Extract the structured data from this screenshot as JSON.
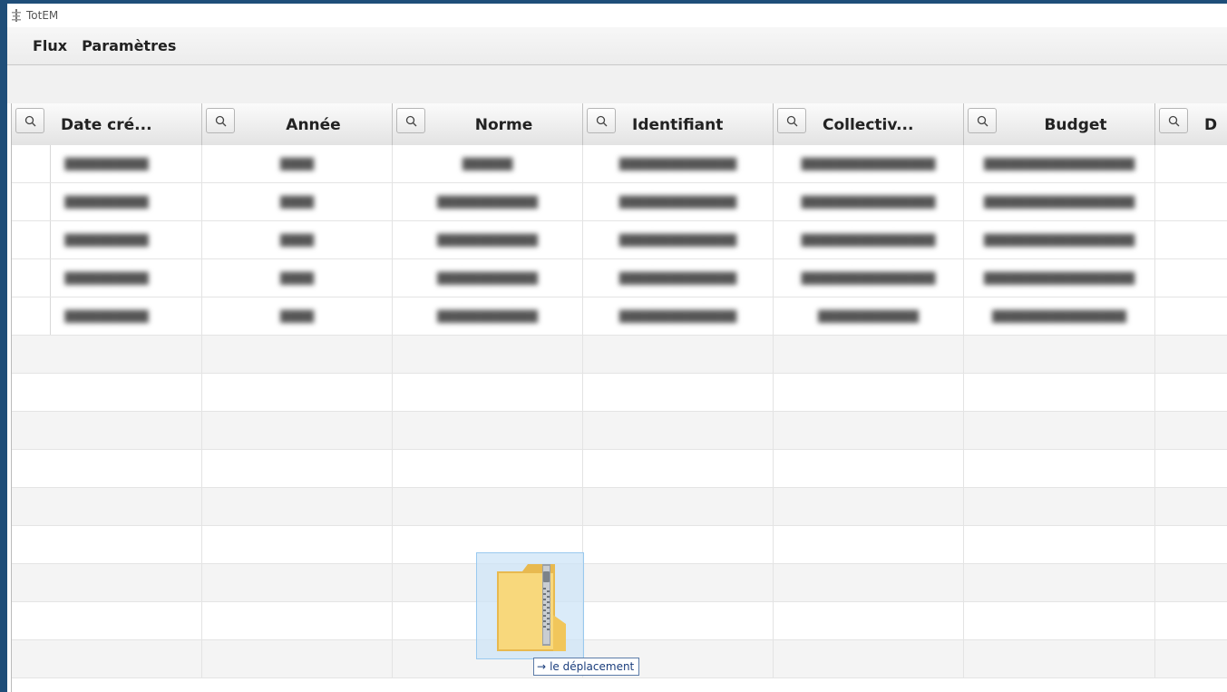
{
  "window": {
    "title": "TotEM"
  },
  "menu": [
    "Flux",
    "Paramètres"
  ],
  "table": {
    "columns": [
      "Date cré...",
      "Année",
      "Norme",
      "Identifiant",
      "Collectiv...",
      "Budget",
      "D"
    ],
    "rows": [
      [
        "██████████",
        "████",
        "██████",
        "██████████████",
        "████████████████",
        "██████████████████"
      ],
      [
        "██████████",
        "████",
        "████████████",
        "██████████████",
        "████████████████",
        "██████████████████"
      ],
      [
        "██████████",
        "████",
        "████████████",
        "██████████████",
        "████████████████",
        "██████████████████"
      ],
      [
        "██████████",
        "████",
        "████████████",
        "██████████████",
        "████████████████",
        "██████████████████"
      ],
      [
        "██████████",
        "████",
        "████████████",
        "██████████████",
        "████████████",
        "████████████████"
      ]
    ],
    "empty_rows": 9
  },
  "drag": {
    "tooltip_arrow": "→",
    "tooltip_text": "le déplacement",
    "icon": "zip-folder-icon"
  }
}
